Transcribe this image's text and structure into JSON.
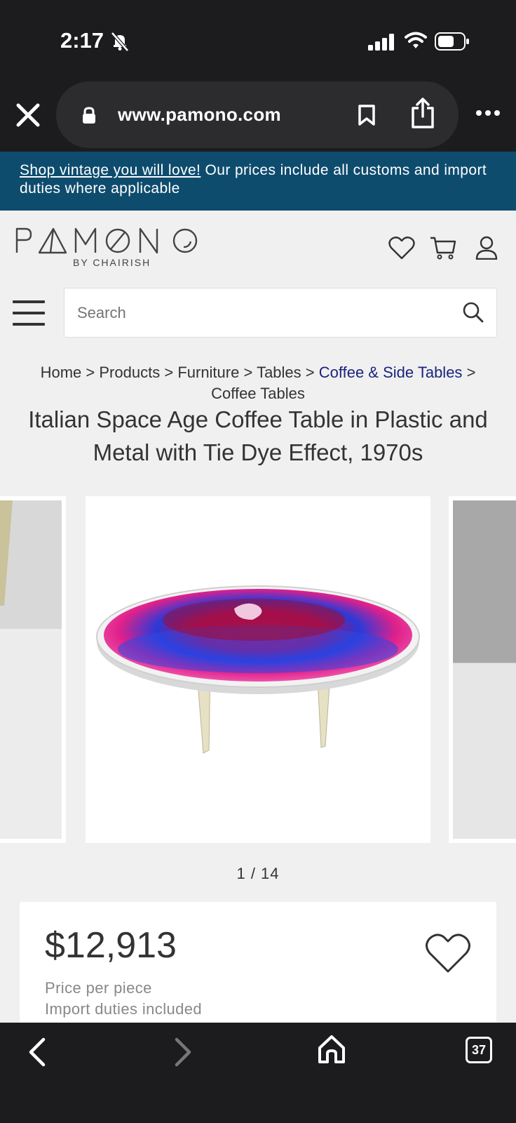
{
  "status": {
    "time": "2:17"
  },
  "browser": {
    "url": "www.pamono.com",
    "tab_count": "37"
  },
  "promo": {
    "link_text": "Shop vintage you will love!",
    "text": " Our prices include all customs and import duties where applicable"
  },
  "header": {
    "logo_sub": "BY CHAIRISH"
  },
  "search": {
    "placeholder": "Search"
  },
  "breadcrumb": {
    "items": [
      "Home",
      "Products",
      "Furniture",
      "Tables",
      "Coffee & Side Tables",
      "Coffee Tables"
    ],
    "separator": ">"
  },
  "product": {
    "title": "Italian Space Age Coffee Table in Plastic and Metal with Tie Dye Effect, 1970s",
    "image_counter": "1 / 14",
    "price": "$12,913",
    "price_note_1": "Price per piece",
    "price_note_2": "Import duties included"
  },
  "colors": {
    "promo_bg": "#0e4c6e",
    "breadcrumb_active": "#1a237e",
    "chrome_bg": "#1c1c1e"
  }
}
